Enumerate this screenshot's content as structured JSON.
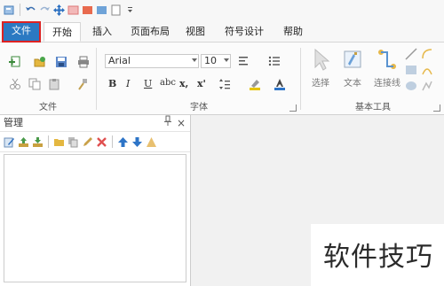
{
  "tabs": {
    "file": "文件",
    "home": "开始",
    "insert": "插入",
    "page_layout": "页面布局",
    "view": "视图",
    "symbol_design": "符号设计",
    "help": "帮助"
  },
  "ribbon": {
    "file_group_label": "文件",
    "font_group_label": "字体",
    "basic_tools_label": "基本工具",
    "font_name": "Arial",
    "font_size": "10",
    "bold": "B",
    "italic": "I",
    "underline": "U",
    "strike": "abc",
    "subscript": "x,",
    "superscript": "x'",
    "select_tool": "选择",
    "text_tool": "文本",
    "connector_tool": "连接线"
  },
  "panel": {
    "title": "管理",
    "pin": "ꟷ",
    "close": "×"
  },
  "watermark": "软件技巧",
  "colors": {
    "file_tab_bg": "#2b79c2",
    "file_tab_border": "#dd2222",
    "accent_blue": "#2d74c7"
  }
}
